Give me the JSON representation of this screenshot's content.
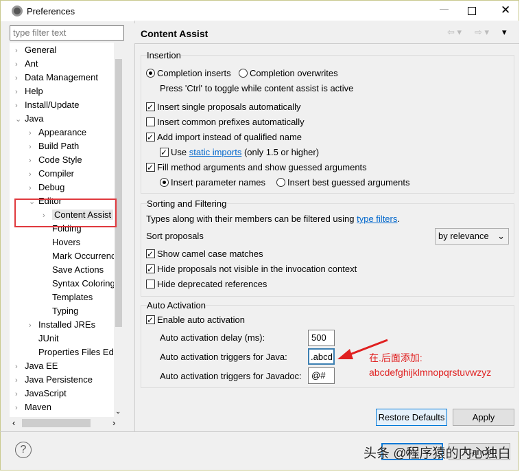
{
  "window": {
    "title": "Preferences",
    "icon": "eclipse-gear-icon"
  },
  "filter": {
    "placeholder": "type filter text"
  },
  "tree": [
    {
      "label": "General",
      "depth": 0,
      "chev": "›"
    },
    {
      "label": "Ant",
      "depth": 0,
      "chev": "›"
    },
    {
      "label": "Data Management",
      "depth": 0,
      "chev": "›"
    },
    {
      "label": "Help",
      "depth": 0,
      "chev": "›"
    },
    {
      "label": "Install/Update",
      "depth": 0,
      "chev": "›"
    },
    {
      "label": "Java",
      "depth": 0,
      "chev": "⌄"
    },
    {
      "label": "Appearance",
      "depth": 1,
      "chev": "›"
    },
    {
      "label": "Build Path",
      "depth": 1,
      "chev": "›"
    },
    {
      "label": "Code Style",
      "depth": 1,
      "chev": "›"
    },
    {
      "label": "Compiler",
      "depth": 1,
      "chev": "›"
    },
    {
      "label": "Debug",
      "depth": 1,
      "chev": "›"
    },
    {
      "label": "Editor",
      "depth": 1,
      "chev": "⌄"
    },
    {
      "label": "Content Assist",
      "depth": 2,
      "chev": "›",
      "selected": true
    },
    {
      "label": "Folding",
      "depth": 2
    },
    {
      "label": "Hovers",
      "depth": 2
    },
    {
      "label": "Mark Occurrences",
      "depth": 2
    },
    {
      "label": "Save Actions",
      "depth": 2
    },
    {
      "label": "Syntax Coloring",
      "depth": 2
    },
    {
      "label": "Templates",
      "depth": 2
    },
    {
      "label": "Typing",
      "depth": 2
    },
    {
      "label": "Installed JREs",
      "depth": 1,
      "chev": "›"
    },
    {
      "label": "JUnit",
      "depth": 1
    },
    {
      "label": "Properties Files Editor",
      "depth": 1
    },
    {
      "label": "Java EE",
      "depth": 0,
      "chev": "›"
    },
    {
      "label": "Java Persistence",
      "depth": 0,
      "chev": "›"
    },
    {
      "label": "JavaScript",
      "depth": 0,
      "chev": "›"
    },
    {
      "label": "Maven",
      "depth": 0,
      "chev": "›"
    }
  ],
  "page": {
    "title": "Content Assist"
  },
  "insertion": {
    "label": "Insertion",
    "completion_inserts": "Completion inserts",
    "completion_overwrites": "Completion overwrites",
    "toggle_hint": "Press 'Ctrl' to toggle while content assist is active",
    "insert_single": "Insert single proposals automatically",
    "insert_prefixes": "Insert common prefixes automatically",
    "add_import": "Add import instead of qualified name",
    "use": "Use",
    "static_imports": "static imports",
    "only15": "(only 1.5 or higher)",
    "fill_args": "Fill method arguments and show guessed arguments",
    "insert_param_names": "Insert parameter names",
    "insert_best_guessed": "Insert best guessed arguments"
  },
  "sorting": {
    "label": "Sorting and Filtering",
    "types_text": "Types along with their members can be filtered using",
    "type_filters": "type filters",
    "sort_label": "Sort proposals",
    "sort_value": "by relevance",
    "camel": "Show camel case matches",
    "hide_not_visible": "Hide proposals not visible in the invocation context",
    "hide_deprecated": "Hide deprecated references"
  },
  "auto": {
    "label": "Auto Activation",
    "enable": "Enable auto activation",
    "delay_label": "Auto activation delay (ms):",
    "delay_value": "500",
    "java_label": "Auto activation triggers for Java:",
    "java_value": ".abcd",
    "javadoc_label": "Auto activation triggers for Javadoc:",
    "javadoc_value": "@#"
  },
  "annotation": {
    "line1": "在.后面添加:",
    "line2": "abcdefghijklmnopqrstuvwzyz",
    "color": "#e02020"
  },
  "buttons": {
    "restore": "Restore Defaults",
    "apply": "Apply",
    "ok": "OK",
    "cancel": "Cancel"
  },
  "watermark": "头条 @程序猿的内心独白"
}
